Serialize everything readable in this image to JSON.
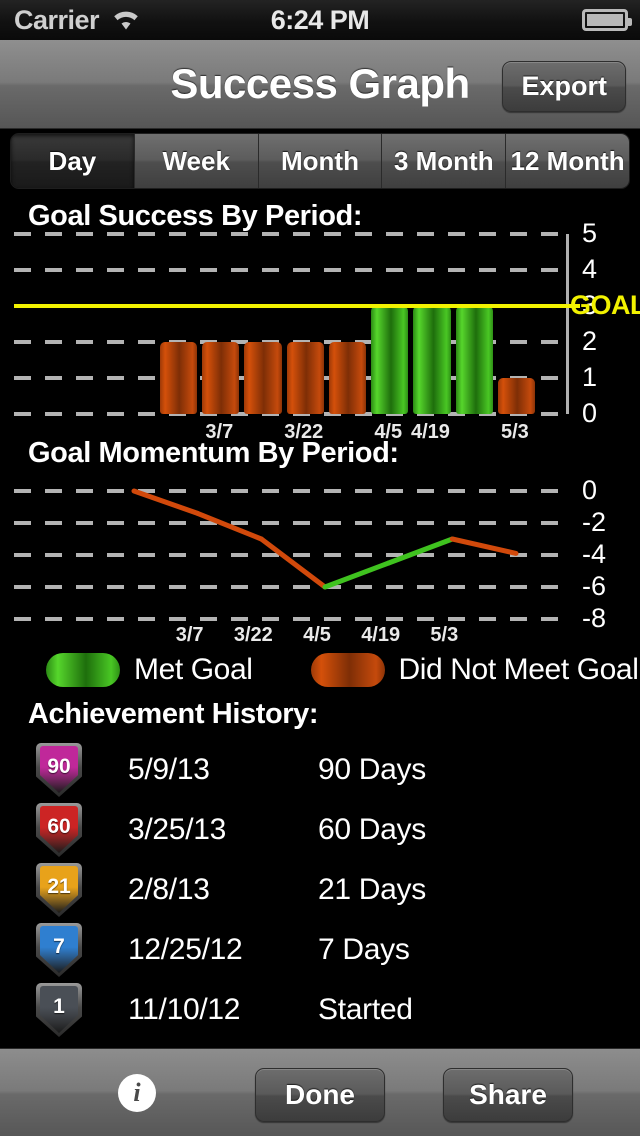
{
  "status_bar": {
    "carrier": "Carrier",
    "wifi_icon": "wifi-icon",
    "time": "6:24 PM",
    "battery_icon": "battery-full-icon"
  },
  "nav": {
    "title": "Success Graph",
    "export_label": "Export"
  },
  "segmented": {
    "selected": "Day",
    "options": [
      "Day",
      "Week",
      "Month",
      "3 Month",
      "12 Month"
    ]
  },
  "sections": {
    "success_title": "Goal Success By Period:",
    "momentum_title": "Goal Momentum By Period:",
    "achievement_title": "Achievement History:"
  },
  "legend": {
    "items": [
      {
        "label": "Met Goal",
        "color": "#3FC21F"
      },
      {
        "label": "Did Not Meet Goal",
        "color": "#C04A10"
      }
    ]
  },
  "achievements": [
    {
      "badge": "90",
      "badge_color": "#C0289A",
      "date": "5/9/13",
      "value": "90 Days"
    },
    {
      "badge": "60",
      "badge_color": "#CC2424",
      "date": "3/25/13",
      "value": "60 Days"
    },
    {
      "badge": "21",
      "badge_color": "#E8A21A",
      "date": "2/8/13",
      "value": "21 Days"
    },
    {
      "badge": "7",
      "badge_color": "#2F7FD0",
      "date": "12/25/12",
      "value": "7 Days"
    },
    {
      "badge": "1",
      "badge_color": "#4A4F56",
      "date": "11/10/12",
      "value": "Started"
    }
  ],
  "toolbar": {
    "info_icon": "info-icon",
    "info_glyph": "i",
    "done_label": "Done",
    "share_label": "Share"
  },
  "chart_data": [
    {
      "type": "bar",
      "title": "Goal Success By Period:",
      "xlabel": "",
      "ylabel": "",
      "ylim": [
        0,
        5
      ],
      "yticks": [
        0,
        1,
        2,
        3,
        4,
        5
      ],
      "ytick_labels": [
        "0",
        "1",
        "2",
        "3",
        "4",
        "5"
      ],
      "grid": true,
      "categories": [
        "3/7",
        "3/22",
        "4/5",
        "4/19",
        "5/3"
      ],
      "tick_positions": [
        1,
        3,
        5,
        6,
        8
      ],
      "goal_line": {
        "value": 3,
        "label": "GOAL",
        "color": "#F2F200"
      },
      "values": [
        2,
        2,
        2,
        2,
        2,
        3,
        3,
        3,
        1
      ],
      "bar_colors": [
        "#C04A10",
        "#C04A10",
        "#C04A10",
        "#C04A10",
        "#C04A10",
        "#3FC21F",
        "#3FC21F",
        "#3FC21F",
        "#C04A10"
      ],
      "bar_count": 9,
      "legend": [
        "Met Goal",
        "Did Not Meet Goal"
      ],
      "legend_position": "below"
    },
    {
      "type": "line",
      "title": "Goal Momentum By Period:",
      "xlabel": "",
      "ylabel": "",
      "ylim": [
        -8,
        0
      ],
      "yticks": [
        -8,
        -6,
        -4,
        -2,
        0
      ],
      "ytick_labels": [
        "-8",
        "-6",
        "-4",
        "-2",
        "0"
      ],
      "grid": true,
      "categories": [
        "3/7",
        "3/22",
        "4/5",
        "4/19",
        "5/3"
      ],
      "x": [
        0,
        1,
        2,
        3,
        4,
        5,
        6
      ],
      "values": [
        0,
        -1.4,
        -3.0,
        -6.0,
        -4.5,
        -3.0,
        -3.9
      ],
      "segment_colors": [
        "#D1490B",
        "#D1490B",
        "#D1490B",
        "#3FC21F",
        "#3FC21F",
        "#D1490B"
      ],
      "legend": [
        "Met Goal",
        "Did Not Meet Goal"
      ],
      "legend_position": "below"
    }
  ]
}
